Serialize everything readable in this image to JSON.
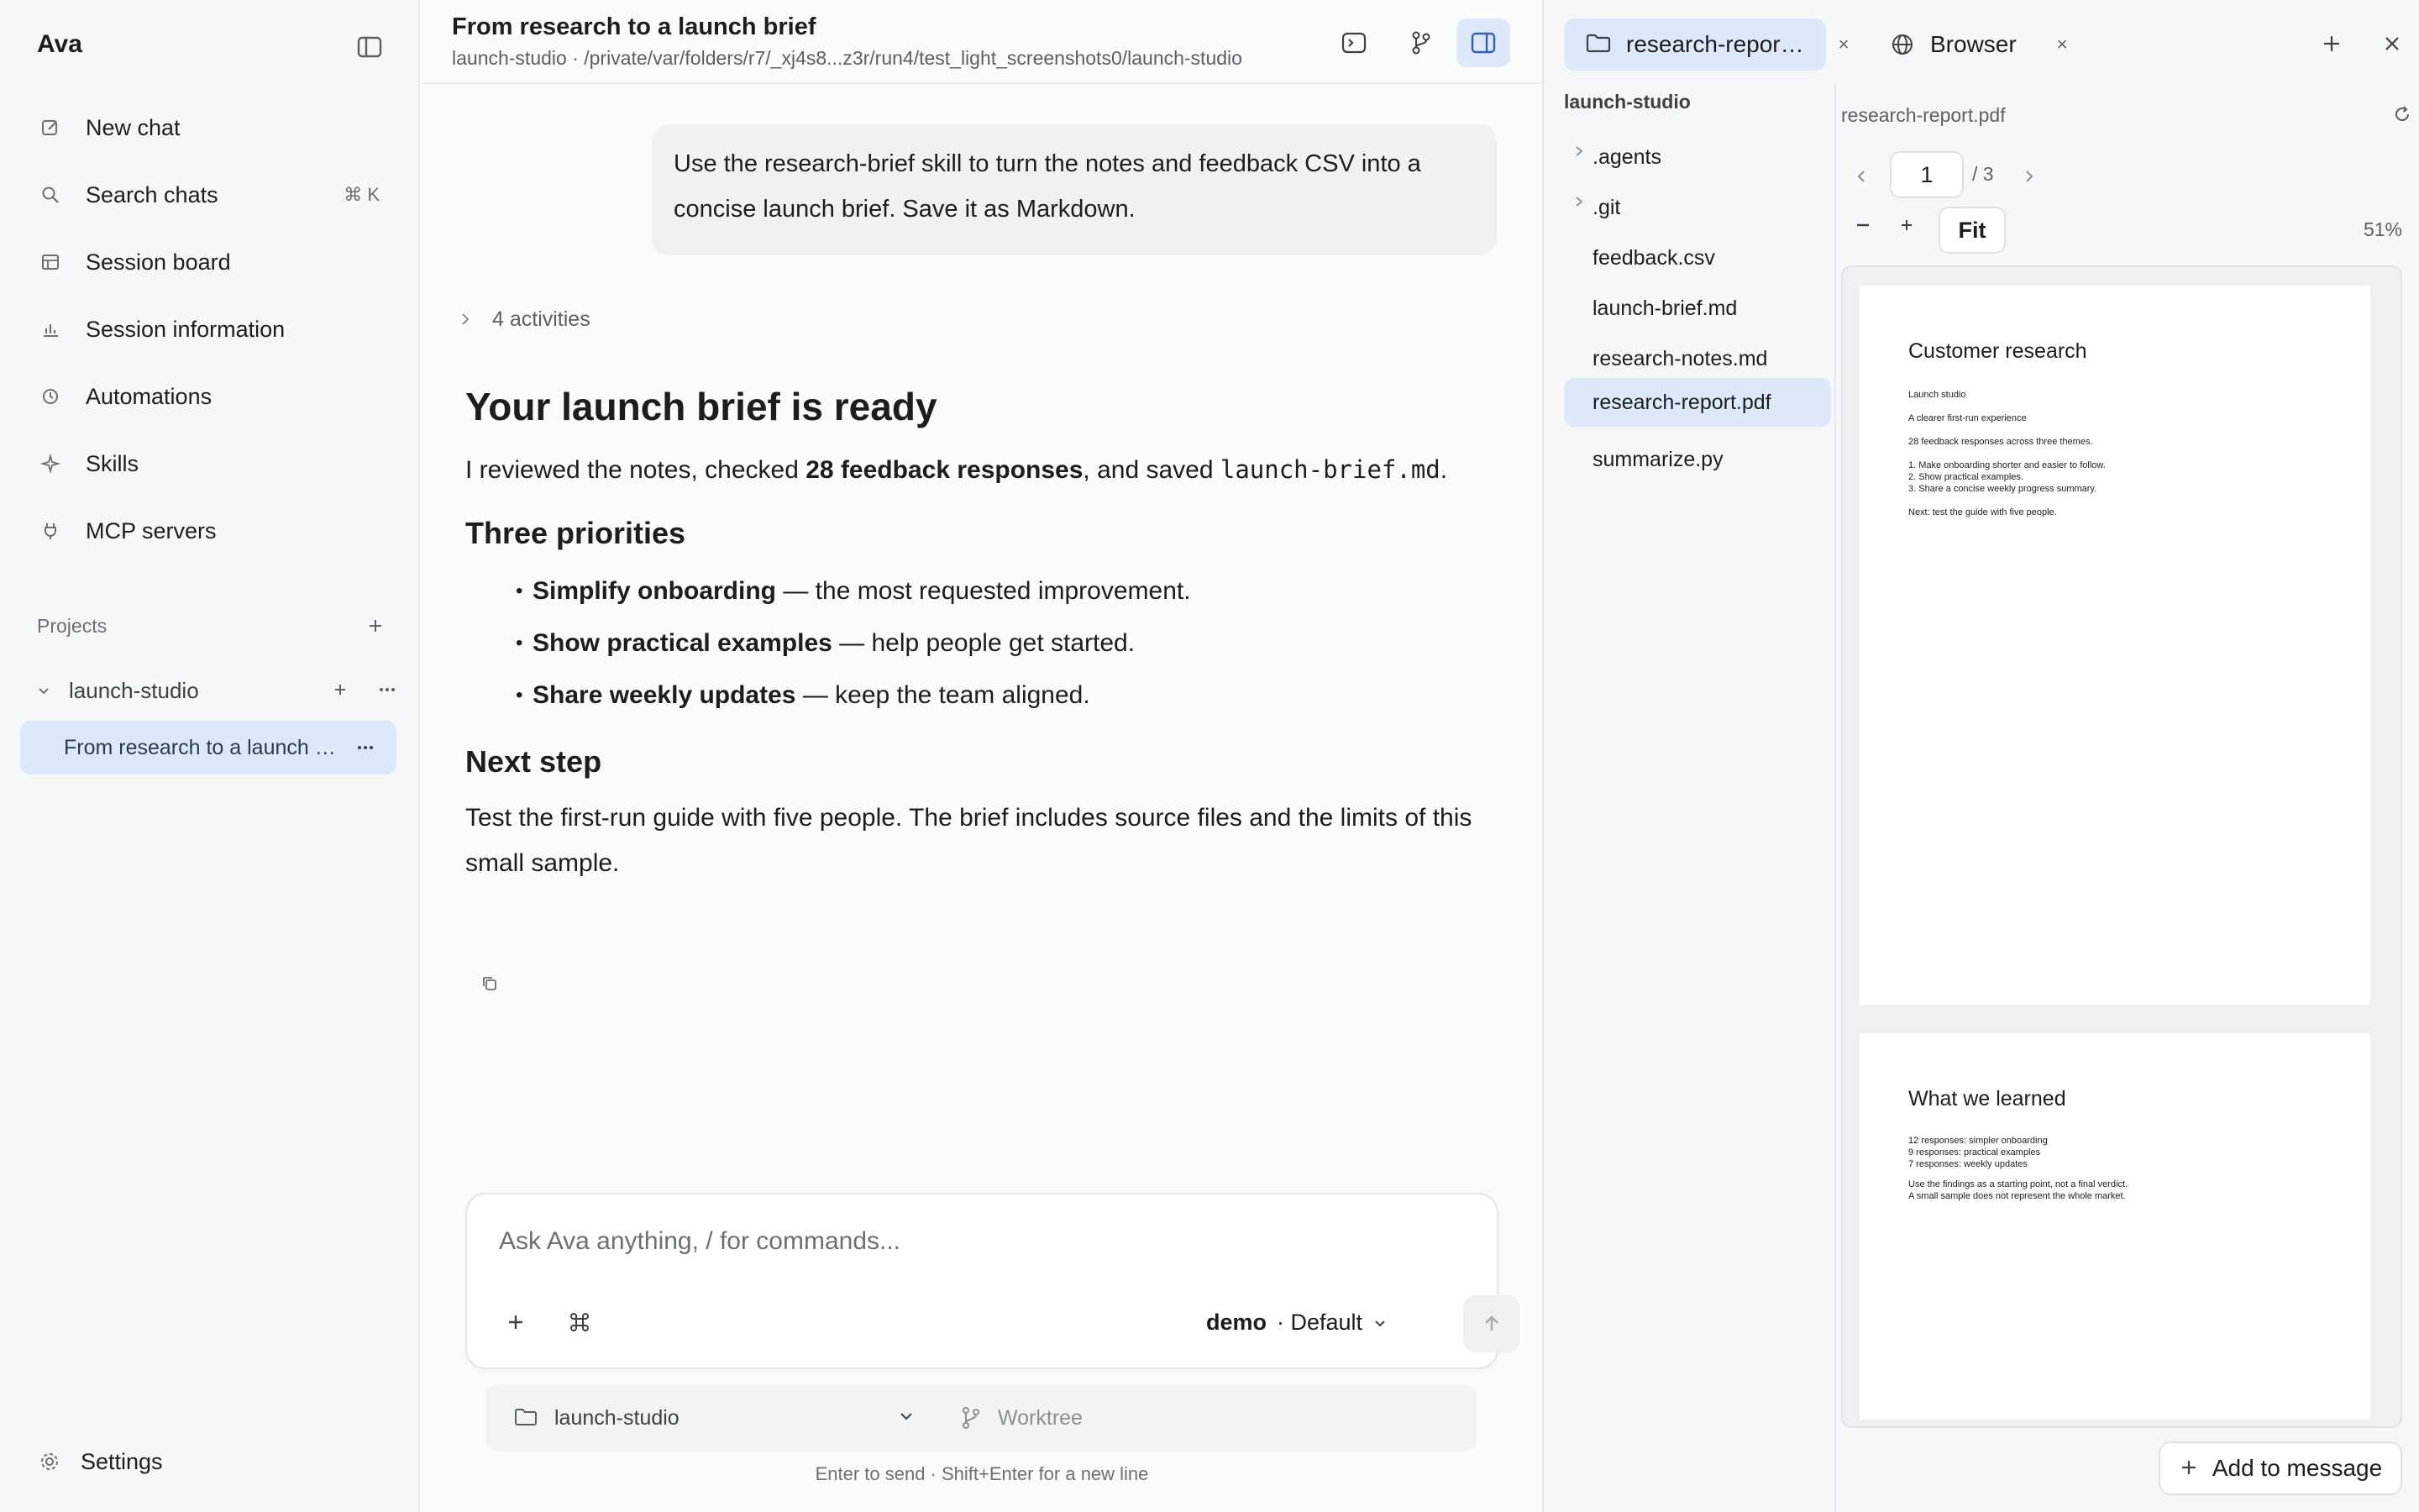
{
  "app": {
    "title": "Ava"
  },
  "sidebar": {
    "nav": [
      {
        "label": "New chat",
        "icon": "edit-icon"
      },
      {
        "label": "Search chats",
        "icon": "search-icon",
        "shortcut": "⌘ K"
      },
      {
        "label": "Session board",
        "icon": "board-icon"
      },
      {
        "label": "Session information",
        "icon": "chart-icon"
      },
      {
        "label": "Automations",
        "icon": "clock-icon"
      },
      {
        "label": "Skills",
        "icon": "sparkle-icon"
      },
      {
        "label": "MCP servers",
        "icon": "plug-icon"
      }
    ],
    "projects_label": "Projects",
    "project": {
      "name": "launch-studio"
    },
    "session": {
      "title": "From research to a launch brief"
    },
    "settings_label": "Settings"
  },
  "main": {
    "title": "From research to a launch brief",
    "path": "launch-studio · /private/var/folders/r7/_xj4s8...z3r/run4/test_light_screenshots0/launch-studio",
    "user_message": "Use the research-brief skill to turn the notes and feedback CSV into a concise launch brief. Save it as Markdown.",
    "activities_label": "4 activities",
    "answer": {
      "heading": "Your launch brief is ready",
      "intro_pre": "I reviewed the notes, checked ",
      "intro_bold": "28 feedback responses",
      "intro_mid": ", and saved ",
      "intro_code": "launch-brief.md",
      "intro_post": ".",
      "priorities_heading": "Three priorities",
      "priorities": [
        {
          "title": "Simplify onboarding",
          "desc": " — the most requested improvement."
        },
        {
          "title": "Show practical examples",
          "desc": " — help people get started."
        },
        {
          "title": "Share weekly updates",
          "desc": " — keep the team aligned."
        }
      ],
      "next_heading": "Next step",
      "next_text": "Test the first-run guide with five people. The brief includes source files and the limits of this small sample."
    },
    "composer": {
      "placeholder": "Ask Ava anything, / for commands...",
      "model_name": "demo",
      "model_mode": "· Default",
      "project": "launch-studio",
      "worktree": "Worktree",
      "hint": "Enter to send · Shift+Enter for a new line"
    }
  },
  "right_panel": {
    "tabs": [
      {
        "label": "research-report...",
        "icon": "folder-icon"
      },
      {
        "label": "Browser",
        "icon": "globe-icon"
      }
    ],
    "tree": {
      "root": "launch-studio",
      "items": [
        {
          "name": ".agents",
          "folder": true
        },
        {
          "name": ".git",
          "folder": true
        },
        {
          "name": "feedback.csv",
          "folder": false
        },
        {
          "name": "launch-brief.md",
          "folder": false
        },
        {
          "name": "research-notes.md",
          "folder": false
        },
        {
          "name": "research-report.pdf",
          "folder": false,
          "selected": true
        },
        {
          "name": "summarize.py",
          "folder": false
        }
      ]
    },
    "viewer": {
      "file_name": "research-report.pdf",
      "page": "1",
      "total": "/ 3",
      "fit_label": "Fit",
      "zoom": "51%",
      "pages": [
        {
          "heading": "Customer research",
          "lines": [
            "Launch studio",
            "A clearer first-run experience",
            "28 feedback responses across three themes.",
            "1. Make onboarding shorter and easier to follow.",
            "2. Show practical examples.",
            "3. Share a concise weekly progress summary.",
            "Next: test the guide with five people."
          ]
        },
        {
          "heading": "What we learned",
          "lines": [
            "12 responses: simpler onboarding",
            "9 responses: practical examples",
            "7 responses: weekly updates",
            "Use the findings as a starting point, not a final verdict.",
            "A small sample does not represent the whole market."
          ]
        }
      ]
    },
    "add_to_message": "Add to message"
  },
  "colors": {
    "accent_bg": "#dde9fb",
    "sidebar_bg": "#f6f7f9"
  }
}
